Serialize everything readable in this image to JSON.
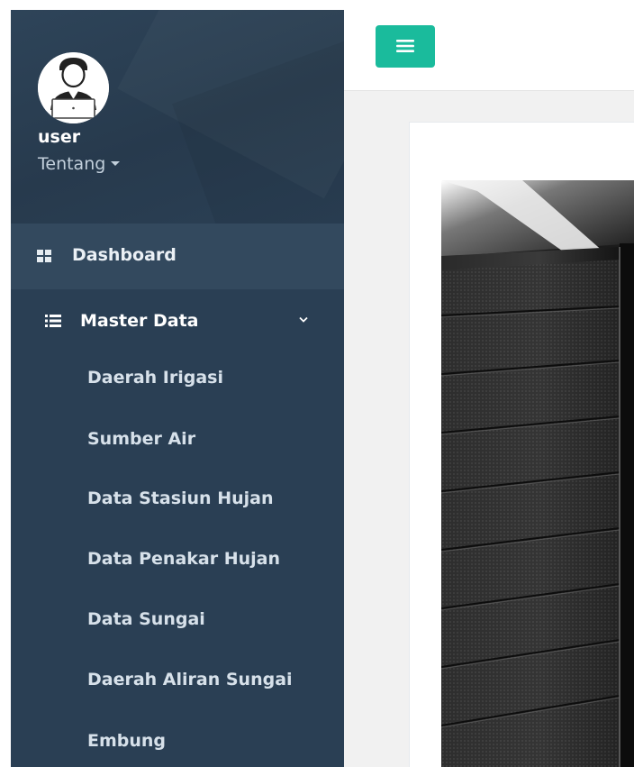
{
  "user": {
    "name": "user",
    "about_label": "Tentang"
  },
  "sidebar": {
    "dashboard_label": "Dashboard",
    "master_label": "Master Data",
    "sub_items": [
      "Daerah Irigasi",
      "Sumber Air",
      "Data Stasiun Hujan",
      "Data Penakar Hujan",
      "Data Sungai",
      "Daerah Aliran Sungai",
      "Embung"
    ]
  },
  "icons": {
    "avatar": "user-laptop-icon",
    "dashboard": "grid-icon",
    "master": "list-icon",
    "master_toggle": "chevron-down-icon",
    "menu_toggle": "hamburger-icon"
  },
  "colors": {
    "sidebar_bg": "#2a3f54",
    "dashboard_active_bg": "#33495e",
    "accent": "#1abb9c",
    "content_bg": "#f1f1f1"
  }
}
